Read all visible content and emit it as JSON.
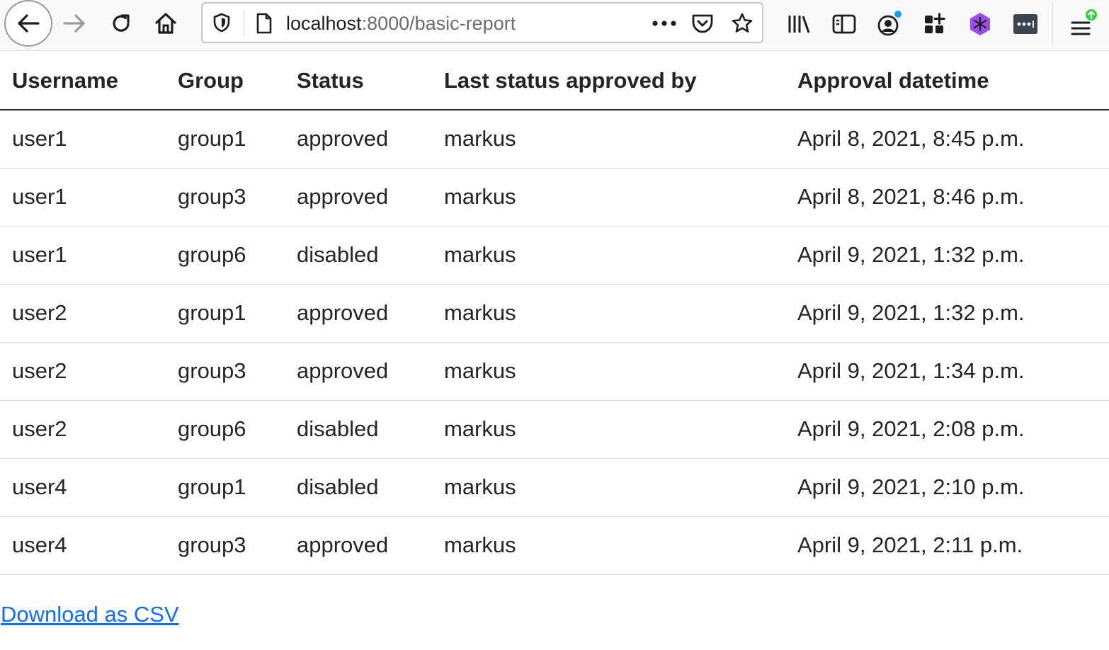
{
  "browser": {
    "url_host": "localhost",
    "url_path": ":8000/basic-report",
    "colors": {
      "account_badge": "#1a9ee6",
      "update_badge": "#2ecc40",
      "extension_purple": "#9b4fe8"
    }
  },
  "table": {
    "headers": [
      "Username",
      "Group",
      "Status",
      "Last status approved by",
      "Approval datetime"
    ],
    "rows": [
      [
        "user1",
        "group1",
        "approved",
        "markus",
        "April 8, 2021, 8:45 p.m."
      ],
      [
        "user1",
        "group3",
        "approved",
        "markus",
        "April 8, 2021, 8:46 p.m."
      ],
      [
        "user1",
        "group6",
        "disabled",
        "markus",
        "April 9, 2021, 1:32 p.m."
      ],
      [
        "user2",
        "group1",
        "approved",
        "markus",
        "April 9, 2021, 1:32 p.m."
      ],
      [
        "user2",
        "group3",
        "approved",
        "markus",
        "April 9, 2021, 1:34 p.m."
      ],
      [
        "user2",
        "group6",
        "disabled",
        "markus",
        "April 9, 2021, 2:08 p.m."
      ],
      [
        "user4",
        "group1",
        "disabled",
        "markus",
        "April 9, 2021, 2:10 p.m."
      ],
      [
        "user4",
        "group3",
        "approved",
        "markus",
        "April 9, 2021, 2:11 p.m."
      ]
    ]
  },
  "download_link": "Download as CSV"
}
